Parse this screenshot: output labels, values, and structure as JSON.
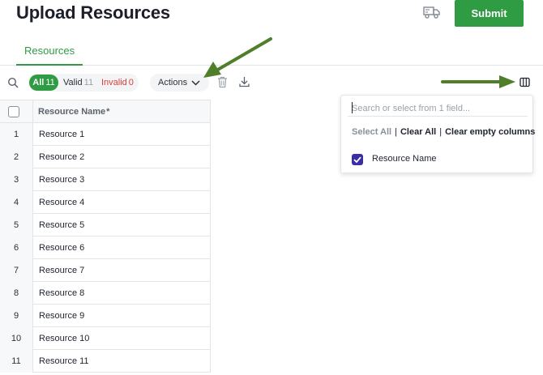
{
  "header": {
    "title": "Upload Resources",
    "submit_label": "Submit",
    "shipping_icon": "truck-icon"
  },
  "tabs": [
    {
      "label": "Resources",
      "active": true
    }
  ],
  "toolbar": {
    "filters": {
      "all_label": "All",
      "all_count": "11",
      "valid_label": "Valid",
      "valid_count": "11",
      "invalid_label": "Invalid",
      "invalid_count": "0"
    },
    "actions_label": "Actions",
    "icons": [
      "search-icon",
      "trash-icon",
      "download-icon",
      "columns-icon"
    ]
  },
  "grid": {
    "column_header": "Resource Name",
    "required_marker": "*",
    "rows": [
      {
        "num": "1",
        "name": "Resource 1"
      },
      {
        "num": "2",
        "name": "Resource 2"
      },
      {
        "num": "3",
        "name": "Resource 3"
      },
      {
        "num": "4",
        "name": "Resource 4"
      },
      {
        "num": "5",
        "name": "Resource 5"
      },
      {
        "num": "6",
        "name": "Resource 6"
      },
      {
        "num": "7",
        "name": "Resource 7"
      },
      {
        "num": "8",
        "name": "Resource 8"
      },
      {
        "num": "9",
        "name": "Resource 9"
      },
      {
        "num": "10",
        "name": "Resource 10"
      },
      {
        "num": "11",
        "name": "Resource 11"
      }
    ]
  },
  "column_panel": {
    "search_placeholder": "Search or select from 1 field...",
    "select_all": "Select All",
    "clear_all": "Clear All",
    "clear_empty": "Clear empty columns",
    "separator": "|",
    "options": [
      {
        "label": "Resource Name",
        "checked": true
      }
    ]
  },
  "colors": {
    "brand_green": "#2f9c44",
    "invalid_red": "#e03b3b",
    "checkbox_purple": "#3a2fa0",
    "annotation_arrow": "#4f7f2a"
  }
}
